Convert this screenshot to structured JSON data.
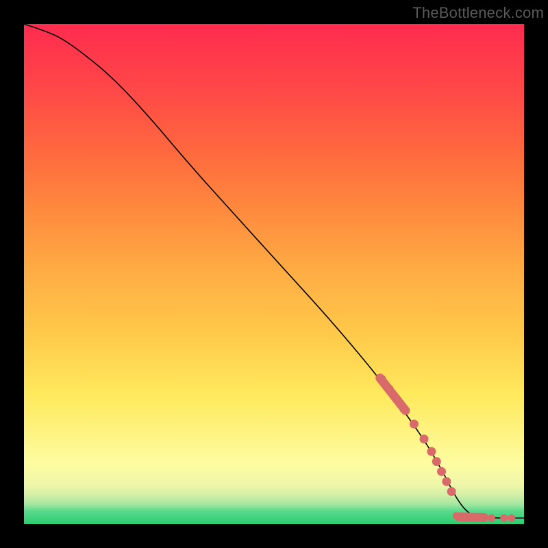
{
  "watermark": "TheBottleneck.com",
  "colors": {
    "background": "#000000",
    "curve": "#000000",
    "marker": "#d86a6a"
  },
  "chart_data": {
    "type": "line",
    "title": "",
    "xlabel": "",
    "ylabel": "",
    "xlim": [
      0,
      100
    ],
    "ylim": [
      0,
      100
    ],
    "grid": false,
    "legend": false,
    "series": [
      {
        "name": "curve",
        "x": [
          0,
          3,
          7,
          12,
          18,
          25,
          33,
          42,
          52,
          62,
          72,
          80,
          84,
          86,
          88,
          90,
          94,
          100
        ],
        "values": [
          100,
          99,
          97.5,
          94,
          89,
          81.5,
          72,
          62,
          51,
          40,
          28,
          17,
          10,
          6,
          3,
          1.5,
          1.2,
          1.2
        ]
      }
    ],
    "markers_on_curve": [
      {
        "x": 71.5,
        "y": 29
      },
      {
        "x": 73.0,
        "y": 27
      },
      {
        "x": 74.5,
        "y": 25
      },
      {
        "x": 76.0,
        "y": 23
      },
      {
        "x": 78.0,
        "y": 20
      },
      {
        "x": 80.0,
        "y": 17
      },
      {
        "x": 81.5,
        "y": 14.5
      },
      {
        "x": 82.5,
        "y": 12.5
      },
      {
        "x": 83.5,
        "y": 10.5
      },
      {
        "x": 84.5,
        "y": 8.5
      },
      {
        "x": 85.5,
        "y": 6.5
      }
    ],
    "markers_flat": [
      {
        "x": 86.5,
        "y": 1.6
      },
      {
        "x": 87.5,
        "y": 1.5
      },
      {
        "x": 88.5,
        "y": 1.4
      },
      {
        "x": 89.5,
        "y": 1.3
      },
      {
        "x": 90.5,
        "y": 1.3
      },
      {
        "x": 91.5,
        "y": 1.3
      },
      {
        "x": 93.5,
        "y": 1.2
      },
      {
        "x": 96.0,
        "y": 1.2
      },
      {
        "x": 97.5,
        "y": 1.2
      }
    ],
    "pill_segments": [
      {
        "x0": 71.2,
        "y0": 29.2,
        "x1": 76.3,
        "y1": 22.7
      },
      {
        "x0": 87.0,
        "y0": 1.4,
        "x1": 92.0,
        "y1": 1.3
      }
    ]
  }
}
